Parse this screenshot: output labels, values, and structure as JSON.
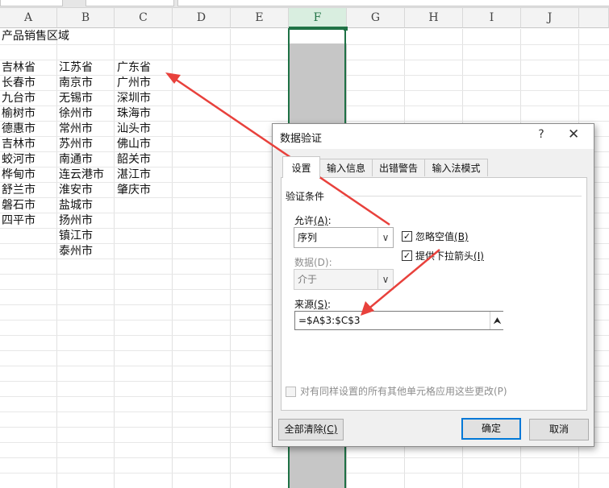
{
  "spreadsheet": {
    "columns": [
      "A",
      "B",
      "C",
      "D",
      "E",
      "F",
      "G",
      "H",
      "I",
      "J"
    ],
    "selected_column": "F",
    "cells": {
      "A1": "产品销售区域",
      "A": [
        "吉林省",
        "长春市",
        "九台市",
        "榆树市",
        "德惠市",
        "吉林市",
        "蛟河市",
        "桦甸市",
        "舒兰市",
        "磐石市",
        "四平市"
      ],
      "B": [
        "江苏省",
        "南京市",
        "无锡市",
        "徐州市",
        "常州市",
        "苏州市",
        "南通市",
        "连云港市",
        "淮安市",
        "盐城市",
        "扬州市",
        "镇江市",
        "泰州市"
      ],
      "C": [
        "广东省",
        "广州市",
        "深圳市",
        "珠海市",
        "汕头市",
        "佛山市",
        "韶关市",
        "湛江市",
        "肇庆市"
      ]
    }
  },
  "dialog": {
    "title": "数据验证",
    "help": "?",
    "close": "✕",
    "tabs": [
      "设置",
      "输入信息",
      "出错警告",
      "输入法模式"
    ],
    "active_tab": "设置",
    "group_title": "验证条件",
    "allow": {
      "label": "允许",
      "key": "(A)",
      "colon": ":",
      "value": "序列"
    },
    "data": {
      "label": "数据(D):",
      "value": "介于"
    },
    "ignore_blank": {
      "label": "忽略空值",
      "key": "(B)",
      "checked": true
    },
    "dropdown_arrow": {
      "label": "提供下拉箭头",
      "key": "(I)",
      "checked": true
    },
    "source": {
      "label": "来源",
      "key": "(S)",
      "colon": ":",
      "value": "=$A$3:$C$3"
    },
    "apply_all": {
      "label": "对有同样设置的所有其他单元格应用这些更改(P)",
      "checked": false
    },
    "buttons": {
      "clear_all": "全部清除",
      "clear_all_key": "(C)",
      "ok": "确定",
      "cancel": "取消"
    }
  },
  "colors": {
    "selection_green": "#1e7145",
    "arrow_red": "#e8413c",
    "primary_blue": "#0078d7"
  }
}
